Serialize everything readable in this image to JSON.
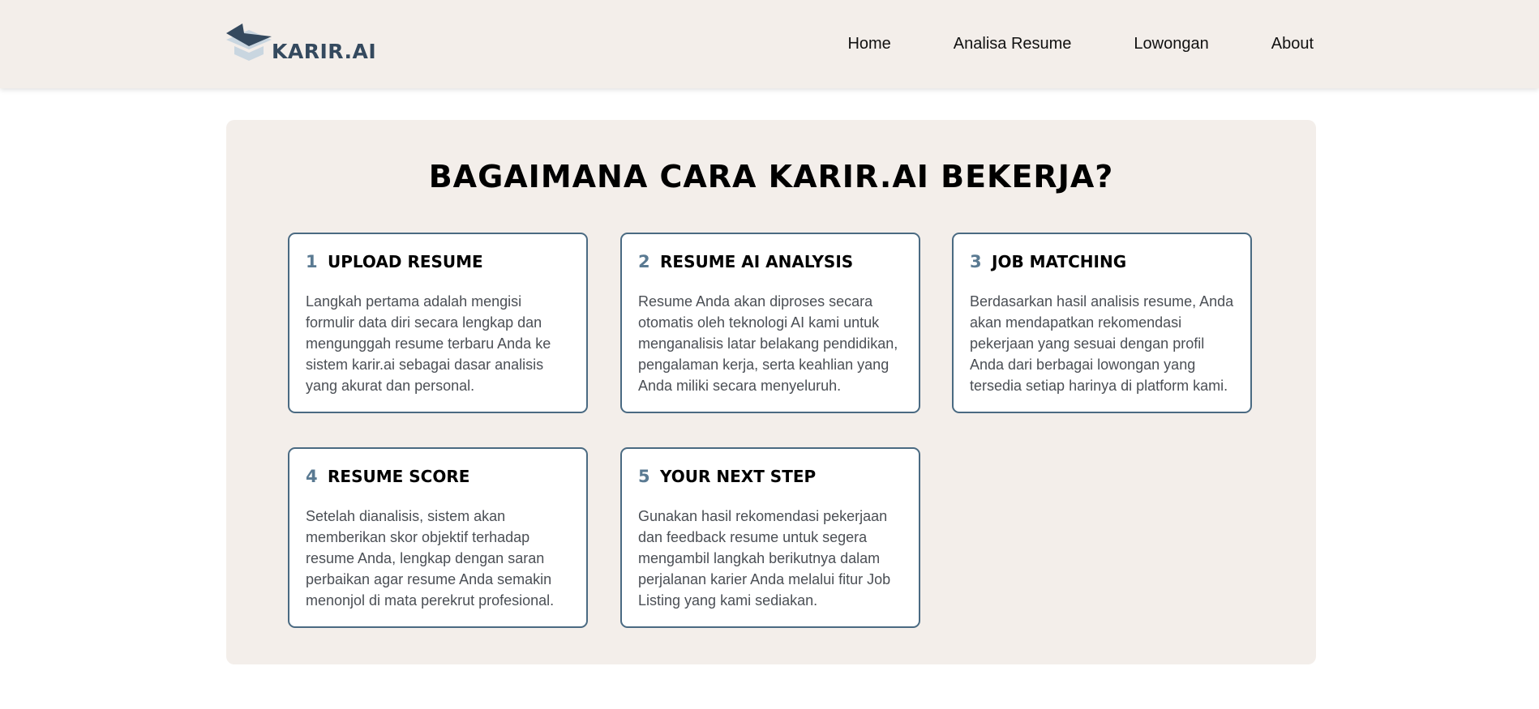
{
  "header": {
    "logo_text": "KARIR.AI",
    "nav": [
      {
        "label": "Home"
      },
      {
        "label": "Analisa Resume"
      },
      {
        "label": "Lowongan"
      },
      {
        "label": "About"
      }
    ]
  },
  "main": {
    "title": "BAGAIMANA CARA KARIR.AI BEKERJA?",
    "steps": [
      {
        "number": "1",
        "title": "UPLOAD RESUME",
        "description": "Langkah pertama adalah mengisi formulir data diri secara lengkap dan mengunggah resume terbaru Anda ke sistem karir.ai sebagai dasar analisis yang akurat dan personal."
      },
      {
        "number": "2",
        "title": "RESUME AI ANALYSIS",
        "description": "Resume Anda akan diproses secara otomatis oleh teknologi AI kami untuk menganalisis latar belakang pendidikan, pengalaman kerja, serta keahlian yang Anda miliki secara menyeluruh."
      },
      {
        "number": "3",
        "title": "JOB MATCHING",
        "description": "Berdasarkan hasil analisis resume, Anda akan mendapatkan rekomendasi pekerjaan yang sesuai dengan profil Anda dari berbagai lowongan yang tersedia setiap harinya di platform kami."
      },
      {
        "number": "4",
        "title": "RESUME SCORE",
        "description": "Setelah dianalisis, sistem akan memberikan skor objektif terhadap resume Anda, lengkap dengan saran perbaikan agar resume Anda semakin menonjol di mata perekrut profesional."
      },
      {
        "number": "5",
        "title": "YOUR NEXT STEP",
        "description": "Gunakan hasil rekomendasi pekerjaan dan feedback resume untuk segera mengambil langkah berikutnya dalam perjalanan karier Anda melalui fitur Job Listing yang kami sediakan."
      }
    ]
  },
  "colors": {
    "header_bg": "#f3eeea",
    "panel_bg": "#f3eeea",
    "card_border": "#4a6a82",
    "step_number": "#5a7a92",
    "logo_dark": "#34495e",
    "logo_light": "#c9d6e0"
  }
}
